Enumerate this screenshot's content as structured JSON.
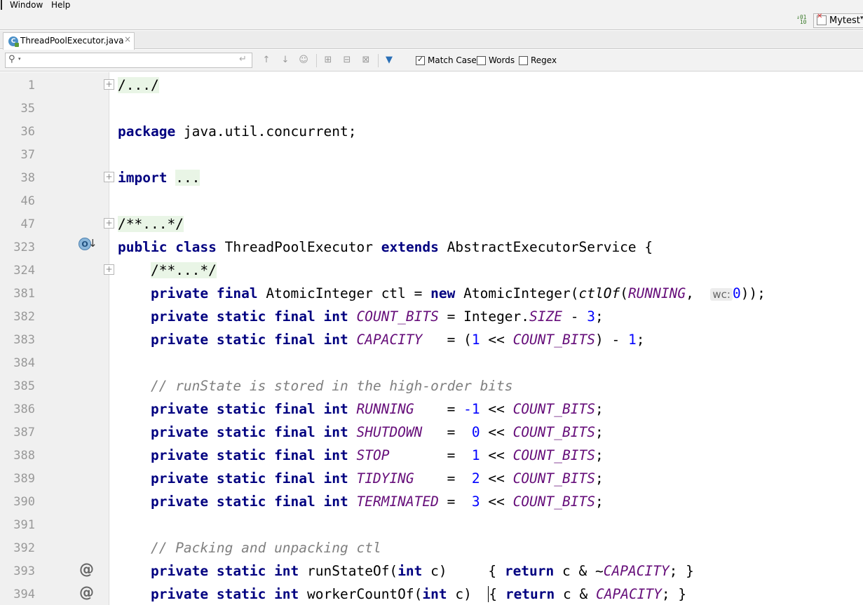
{
  "menu": {
    "items": [
      "Window",
      "Help"
    ]
  },
  "toolbar": {
    "run_config": "Mytest"
  },
  "tab": {
    "label": "ThreadPoolExecutor.java",
    "close": "×"
  },
  "search": {
    "value": "",
    "placeholder": "",
    "options": {
      "match_case": "Match Case",
      "words": "Words",
      "regex": "Regex"
    },
    "match_case_checked": true,
    "words_checked": false,
    "regex_checked": false
  },
  "editor": {
    "line_numbers": [
      "1",
      "35",
      "36",
      "37",
      "38",
      "46",
      "47",
      "323",
      "324",
      "381",
      "382",
      "383",
      "384",
      "385",
      "386",
      "387",
      "388",
      "389",
      "390",
      "391",
      "392",
      "393",
      "394"
    ],
    "code": {
      "l1": "/.../",
      "l36_kw": "package",
      "l36_pkg": " java.util.concurrent;",
      "l38_kw": "import",
      "l38_fold": "...",
      "l47": "/**...*/",
      "l323_public": "public",
      "l323_class": "class",
      "l323_name": " ThreadPoolExecutor ",
      "l323_extends": "extends",
      "l323_rest": " AbstractExecutorService {",
      "l324": "/**...*/",
      "l381_mod": "private final",
      "l381_type": " AtomicInteger ctl = ",
      "l381_new": "new",
      "l381_call": " AtomicInteger(",
      "l381_fn": "ctlOf",
      "l381_open": "(",
      "l381_const": "RUNNING",
      "l381_sep": ",  ",
      "l381_hint": "wc:",
      "l381_num": "0",
      "l381_close": "));",
      "l382_mod": "private static final int",
      "l382_const": "COUNT_BITS",
      "l382_mid": " = Integer.",
      "l382_size": "SIZE",
      "l382_minus": " - ",
      "l382_num": "3",
      "l382_end": ";",
      "l383_mod": "private static final int",
      "l383_const": "CAPACITY",
      "l383_mid": "   = (",
      "l383_num1": "1",
      "l383_shift": " << ",
      "l383_bits": "COUNT_BITS",
      "l383_minus": ") - ",
      "l383_num2": "1",
      "l383_end": ";",
      "l385": "// runState is stored in the high-order bits",
      "states": [
        {
          "name": "RUNNING",
          "pad": "    = ",
          "val": "-1"
        },
        {
          "name": "SHUTDOWN",
          "pad": "   =  ",
          "val": "0"
        },
        {
          "name": "STOP",
          "pad": "       =  ",
          "val": "1"
        },
        {
          "name": "TIDYING",
          "pad": "    =  ",
          "val": "2"
        },
        {
          "name": "TERMINATED",
          "pad": " =  ",
          "val": "3"
        }
      ],
      "state_mod": "private static final int",
      "state_shift": " << ",
      "state_bits": "COUNT_BITS",
      "state_end": ";",
      "l392": "// Packing and unpacking ctl",
      "l393_mod": "private static int",
      "l393_sig1": " runStateOf(",
      "l393_int": "int",
      "l393_sig2": " c)     ",
      "l393_open": "{ ",
      "l393_ret": "return",
      "l393_expr": " c & ~",
      "l393_const": "CAPACITY",
      "l393_end": "; }",
      "l394_mod": "private static int",
      "l394_sig1": " workerCountOf(",
      "l394_int": "int",
      "l394_sig2": " c)  ",
      "l394_open": "{ ",
      "l394_ret": "return",
      "l394_expr": " c & ",
      "l394_const": "CAPACITY",
      "l394_end": "; }"
    }
  },
  "icons": {
    "fold": "plus-fold-icon",
    "override": "at-sign-icon",
    "implemented": "implemented-down-arrow-icon"
  },
  "colors": {
    "keyword": "#000080",
    "constant": "#660e7a",
    "number": "#0000ff",
    "comment": "#808080",
    "folded_bg": "#e9f5e6"
  }
}
